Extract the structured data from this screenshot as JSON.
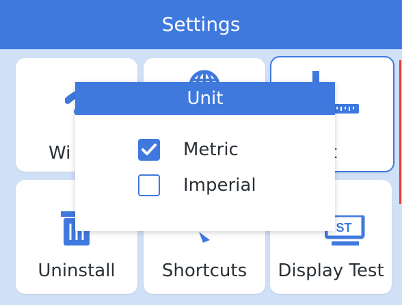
{
  "header": {
    "title": "Settings"
  },
  "tiles": [
    {
      "label": "Wi",
      "icon": "wifi-icon",
      "selected": false
    },
    {
      "label": "",
      "icon": "globe-icon",
      "selected": false
    },
    {
      "label": "nit",
      "icon": "ruler-icon",
      "selected": true
    },
    {
      "label": "Uninstall",
      "icon": "trash-icon",
      "selected": false
    },
    {
      "label": "Shortcuts",
      "icon": "shortcut-icon",
      "selected": false
    },
    {
      "label": "Display Test",
      "icon": "display-test-icon",
      "selected": false
    }
  ],
  "modal": {
    "title": "Unit",
    "options": [
      {
        "label": "Metric",
        "checked": true
      },
      {
        "label": "Imperial",
        "checked": false
      }
    ]
  },
  "icon_badges": {
    "display_test": "ST"
  },
  "colors": {
    "accent": "#3f79de",
    "background": "#cfe0f7",
    "edge_marker": "#e53935"
  }
}
